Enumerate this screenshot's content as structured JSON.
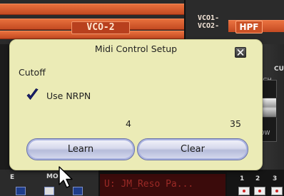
{
  "background": {
    "vco_label": "VCO-2",
    "vco1_label": "VCO1-",
    "vco2_label": "VCO2-",
    "hpf_label": "HPF",
    "cutoff_fader_label": "CU",
    "fader_high": "HIGH",
    "fader_low": "LOW",
    "bottom_left_e": "E",
    "bottom_mode": "MOD",
    "patch_name": "U: JM_Reso Pa...",
    "channel_numbers": [
      "1",
      "2",
      "3"
    ]
  },
  "dialog": {
    "title": "Midi Control Setup",
    "param_name": "Cutoff",
    "use_nrpn_label": "Use NRPN",
    "use_nrpn_checked": true,
    "value_left": "4",
    "value_right": "35",
    "learn_button": "Learn",
    "clear_button": "Clear",
    "close_icon": "close-icon"
  },
  "colors": {
    "dialog_bg": "#ebebb6",
    "accent_orange": "#d4562a",
    "button_border": "#6a73a8"
  }
}
